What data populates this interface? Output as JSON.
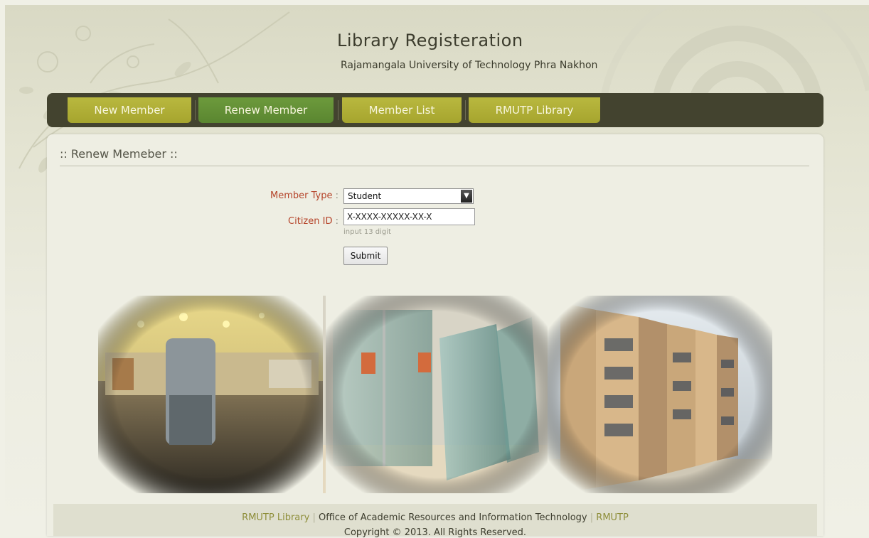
{
  "header": {
    "title": "Library Registeration",
    "subtitle": "Rajamangala University of Technology Phra Nakhon"
  },
  "nav": {
    "items": [
      {
        "label": "New Member",
        "active": false
      },
      {
        "label": "Renew Member",
        "active": true
      },
      {
        "label": "Member List",
        "active": false
      },
      {
        "label": "RMUTP Library",
        "active": false
      }
    ]
  },
  "form": {
    "section_title": ":: Renew Memeber ::",
    "member_type_label": "Member Type",
    "member_type_value": "Student",
    "citizen_id_label": "Citizen ID",
    "citizen_id_value": "X-XXXX-XXXXX-XX-X",
    "citizen_id_hint": "input 13 digit",
    "submit_label": "Submit",
    "colon": ":"
  },
  "footer": {
    "library_link": "RMUTP Library",
    "separator": "|",
    "office_text": "Office of Academic Resources and Information Technology",
    "rmutp_link": "RMUTP",
    "copyright": "Copyright © 2013. All Rights Reserved."
  },
  "colors": {
    "nav_bar": "#43432f",
    "nav_item": "#b9b83f",
    "nav_active": "#6d9a3c",
    "label_red": "#b5442a"
  }
}
